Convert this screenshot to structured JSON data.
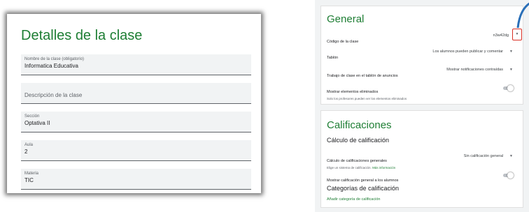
{
  "left": {
    "title": "Detalles de la clase",
    "fields": [
      {
        "label": "Nombre de la clase (obligatorio)",
        "value": "Informatica Educativa"
      },
      {
        "placeholder": "Descripción de la clase"
      },
      {
        "label": "Sección",
        "value": "Optativa II"
      },
      {
        "label": "Aula",
        "value": "2"
      },
      {
        "label": "Materia",
        "value": "TIC"
      }
    ]
  },
  "general": {
    "title": "General",
    "class_code_label": "Código de la clase",
    "class_code_value": "n3w42dg",
    "stream_label": "Tablón",
    "stream_value": "Los alumnos pueden publicar y comentar",
    "classwork_label": "Trabajo de clase en el tablón de anuncios",
    "classwork_value": "Mostrar notificaciones contraídas",
    "deleted_label": "Mostrar elementos eliminados",
    "deleted_sub": "Solo los profesores pueden ver los elementos eliminados"
  },
  "grades": {
    "title": "Calificaciones",
    "calc_heading": "Cálculo de calificación",
    "overall_label": "Cálculo de calificaciones generales",
    "overall_sub": "Elige un sistema de calificación.",
    "overall_sub_link": "Más información",
    "overall_value": "Sin calificación general",
    "show_overall_label": "Mostrar calificación general a los alumnos",
    "categories_heading": "Categorías de calificación",
    "add_category_link": "Añadir categoría de calificación"
  },
  "icons": {
    "dropdown": "chevron-down-icon",
    "code_dropdown": "chevron-down-icon"
  },
  "colors": {
    "accent_green": "#1e7e34",
    "highlight_red": "#d93025",
    "field_bg": "#f1f3f4"
  }
}
